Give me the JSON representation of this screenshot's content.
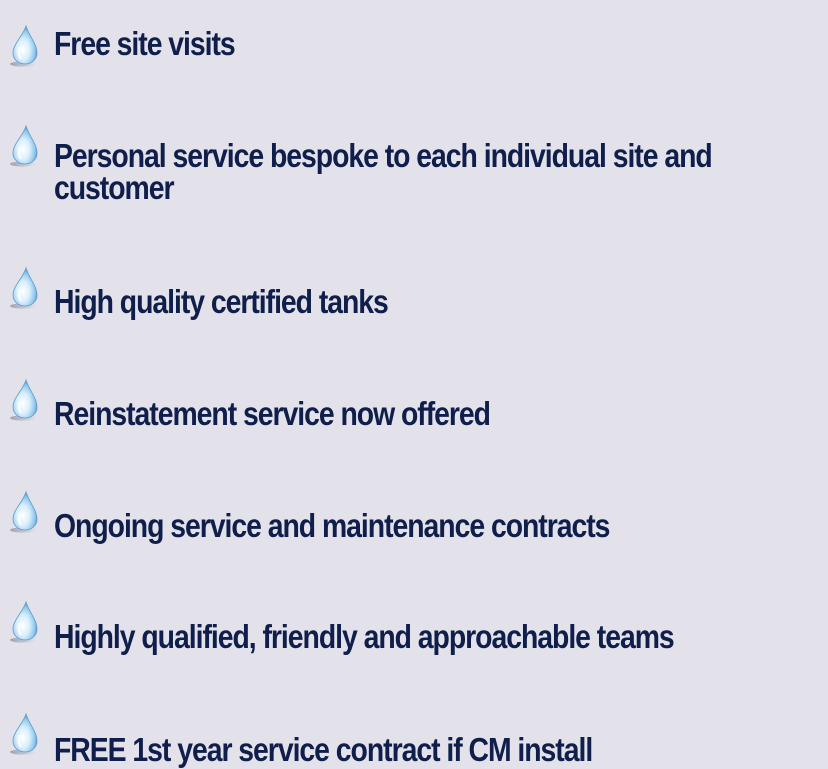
{
  "features": {
    "icon": "water-drop-icon",
    "text_color": "#0f1e4a",
    "background_color": "#e3e2eb",
    "items": [
      {
        "label": "Free site visits"
      },
      {
        "label": "Personal service bespoke to each individual site and customer"
      },
      {
        "label": "High quality certified tanks"
      },
      {
        "label": "Reinstatement service now offered"
      },
      {
        "label": "Ongoing service and maintenance contracts"
      },
      {
        "label": "Highly qualified, friendly and approachable teams"
      },
      {
        "label": "FREE 1st year service contract if CM install"
      }
    ]
  }
}
